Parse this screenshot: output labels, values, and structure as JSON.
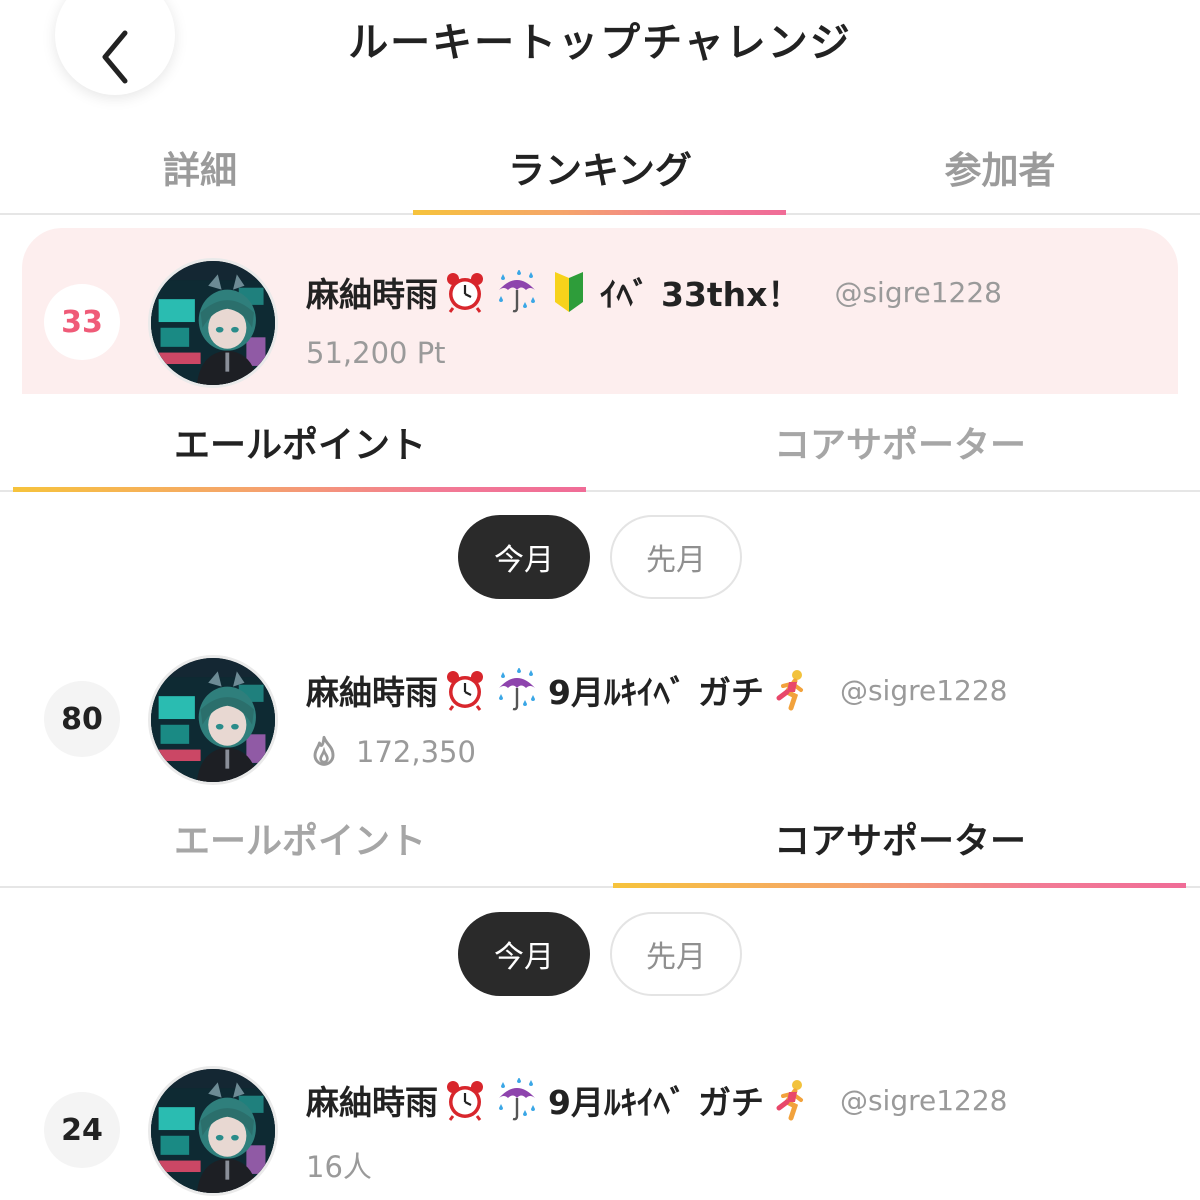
{
  "header": {
    "title": "ルーキートップチャレンジ"
  },
  "tabs": [
    {
      "label": "詳細",
      "active": false
    },
    {
      "label": "ランキング",
      "active": true
    },
    {
      "label": "参加者",
      "active": false
    }
  ],
  "colors": {
    "accent_pink": "#ef5b78",
    "gradient_start": "#f6c33c",
    "gradient_end": "#f06c97",
    "highlight_bg": "#fdeeee"
  },
  "event_entry": {
    "rank": "33",
    "name": "麻紬時雨",
    "emojis": [
      "alarm-clock",
      "umbrella-rain",
      "beginner-mark"
    ],
    "name_suffix": "ｲﾍﾞ 33thx！",
    "handle": "@sigre1228",
    "points": "51,200 Pt"
  },
  "section_yell": {
    "subtabs": [
      {
        "label": "エールポイント",
        "active": true
      },
      {
        "label": "コアサポーター",
        "active": false
      }
    ],
    "periods": [
      {
        "label": "今月",
        "active": true
      },
      {
        "label": "先月",
        "active": false
      }
    ],
    "entry": {
      "rank": "80",
      "name": "麻紬時雨",
      "emojis": [
        "alarm-clock",
        "umbrella-rain"
      ],
      "name_suffix": "9月ﾙｷｲﾍﾞ ガチ",
      "trailing_emoji": "runner",
      "handle": "@sigre1228",
      "value_icon": "flame-icon",
      "value": "172,350"
    }
  },
  "section_core": {
    "subtabs": [
      {
        "label": "エールポイント",
        "active": false
      },
      {
        "label": "コアサポーター",
        "active": true
      }
    ],
    "periods": [
      {
        "label": "今月",
        "active": true
      },
      {
        "label": "先月",
        "active": false
      }
    ],
    "entry": {
      "rank": "24",
      "name": "麻紬時雨",
      "emojis": [
        "alarm-clock",
        "umbrella-rain"
      ],
      "name_suffix": "9月ﾙｷｲﾍﾞ ガチ",
      "trailing_emoji": "runner",
      "handle": "@sigre1228",
      "value": "16人"
    }
  }
}
